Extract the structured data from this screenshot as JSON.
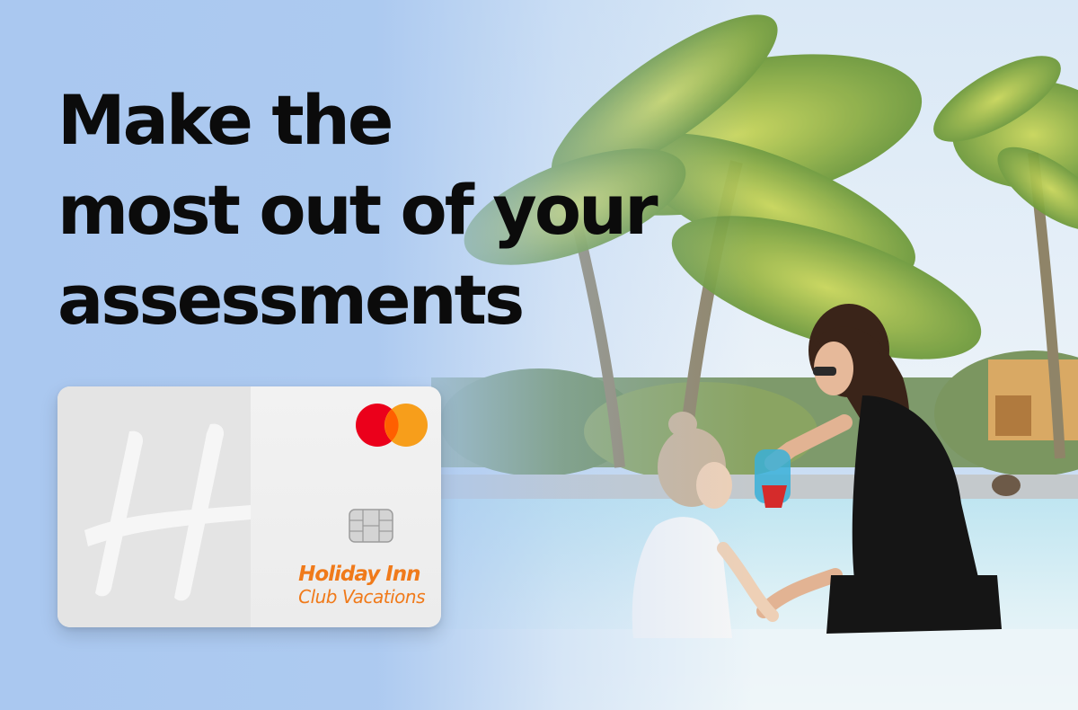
{
  "headline": {
    "line1": "Make the",
    "line2": "most out of your",
    "line3": "assessments"
  },
  "card": {
    "brand_line1": "Holiday Inn",
    "brand_line2": "Club Vacations",
    "network_icon": "mastercard-logo-icon",
    "chip_icon": "emv-chip-icon",
    "logo_icon": "holiday-inn-h-logo-icon"
  },
  "photo": {
    "subject": "mother-and-child-in-pool-photo"
  },
  "colors": {
    "background_blue": "#a9c9ef",
    "headline_text": "#0b0b0b",
    "brand_orange": "#f07a1a",
    "mastercard_red": "#eb001b",
    "mastercard_yellow": "#f79e1b"
  }
}
